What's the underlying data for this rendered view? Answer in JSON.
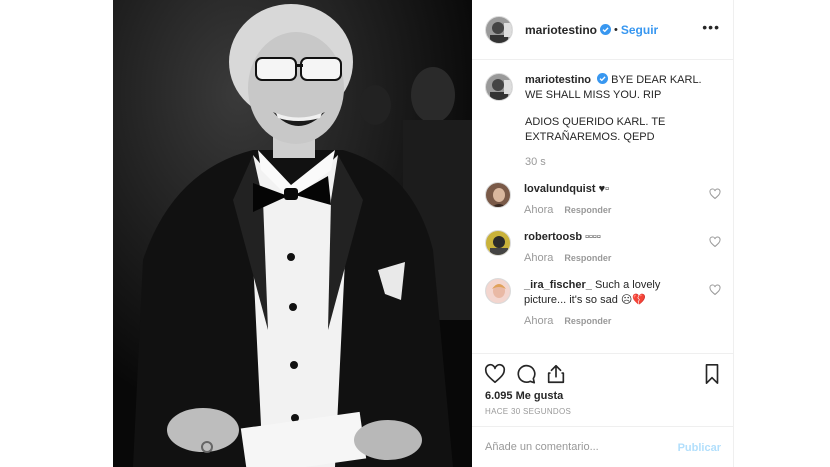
{
  "post": {
    "username": "mariotestino",
    "verified": true,
    "separator": "•",
    "follow_label": "Seguir",
    "more_label": "•••",
    "caption_line1": "BYE DEAR KARL. WE SHALL MISS YOU. RIP",
    "caption_line2": "ADIOS QUERIDO KARL. TE EXTRAÑAREMOS. QEPD",
    "caption_time": "30 s",
    "likes": "6.095 Me gusta",
    "posted_ago": "HACE 30 SEGUNDOS",
    "comment_placeholder": "Añade un comentario...",
    "publish_label": "Publicar"
  },
  "comments": [
    {
      "username": "lovalundquist",
      "text": "♥▫",
      "time": "Ahora",
      "reply_label": "Responder"
    },
    {
      "username": "robertoosb",
      "text": "▫▫▫▫",
      "time": "Ahora",
      "reply_label": "Responder"
    },
    {
      "username": "_ira_fischer_",
      "text": "Such a lovely picture... it's so sad ☹💔",
      "time": "Ahora",
      "reply_label": "Responder"
    }
  ],
  "icons": {
    "verified": "verified-badge-icon",
    "like": "heart-icon",
    "comment": "comment-icon",
    "share": "share-icon",
    "save": "bookmark-icon",
    "options": "more-options-icon"
  },
  "colors": {
    "link_blue": "#3897f0",
    "publish_disabled": "#b2dffc",
    "muted_text": "#999999",
    "border": "#efefef"
  }
}
